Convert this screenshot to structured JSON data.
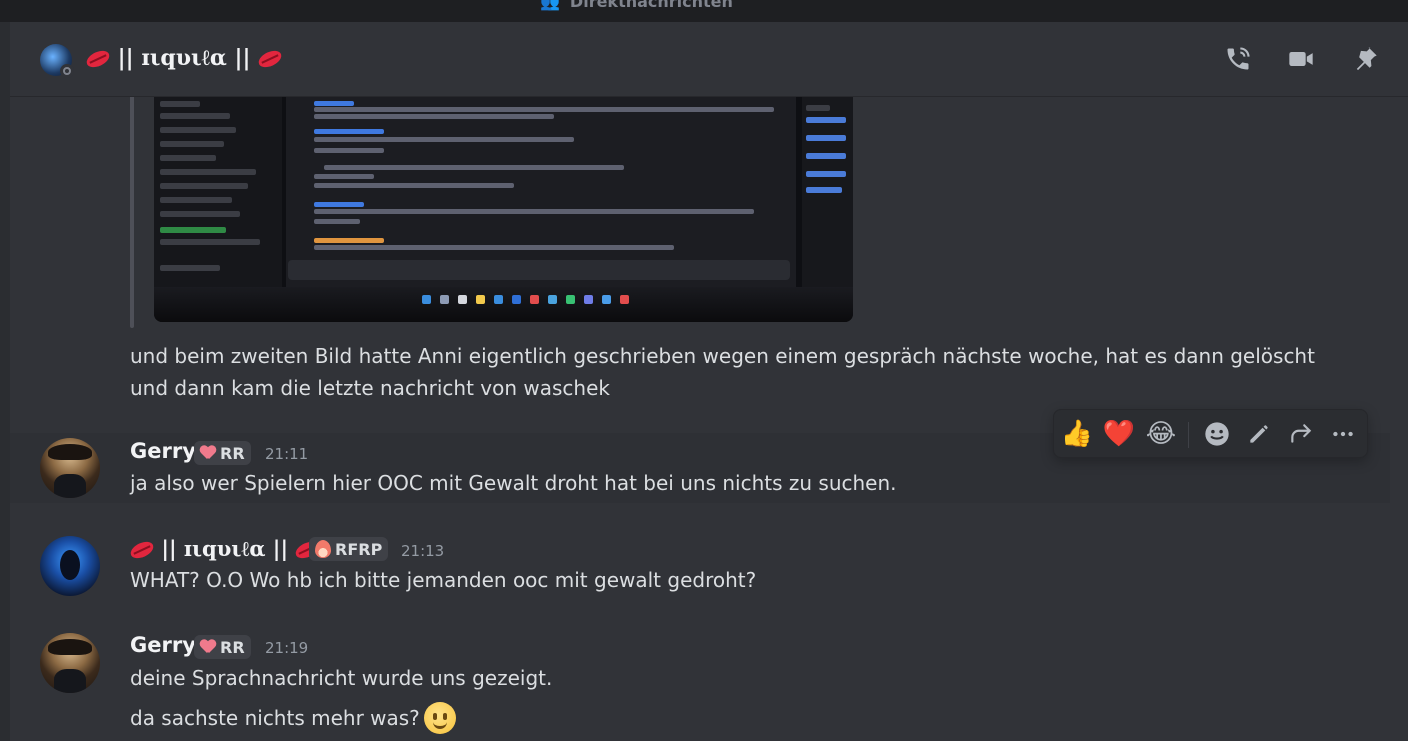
{
  "titlebar": {
    "title": "Direktnachrichten"
  },
  "header": {
    "name": "|| ɪιqυιℓα ||"
  },
  "header_icons": [
    "phone-call-icon",
    "video-camera-icon",
    "pin-icon"
  ],
  "continued_message": {
    "text_line1": "und beim zweiten Bild hatte Anni eigentlich geschrieben wegen einem gespräch nächste woche, hat es dann gelöscht",
    "text_line2": "und dann kam die letzte nachricht von waschek"
  },
  "toolbar": {
    "reactions": [
      "thumbs-up-emoji",
      "red-heart-emoji",
      "tears-of-joy-emoji"
    ],
    "actions": [
      "add-reaction-icon",
      "edit-icon",
      "forward-icon",
      "more-icon"
    ]
  },
  "messages": [
    {
      "author": "Gerry",
      "tag": "RR",
      "time": "21:11",
      "text": "ja also wer Spielern hier OOC mit Gewalt droht hat bei uns nichts zu suchen."
    },
    {
      "author": "|| ɪιqυιℓα ||",
      "tag": "RFRP",
      "time": "21:13",
      "text": "WHAT? O.O Wo hb ich bitte jemanden ooc mit gewalt gedroht?"
    },
    {
      "author": "Gerry",
      "tag": "RR",
      "time": "21:19",
      "text": "deine Sprachnachricht wurde uns gezeigt.",
      "text2": "da sachste nichts mehr was?"
    }
  ]
}
